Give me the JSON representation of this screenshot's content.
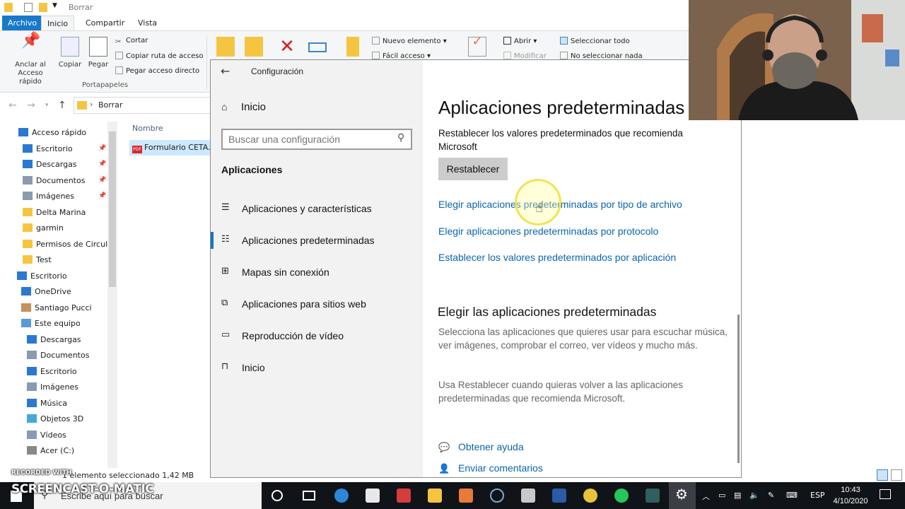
{
  "explorer": {
    "title": "Borrar",
    "tabs": [
      "Archivo",
      "Inicio",
      "Compartir",
      "Vista"
    ],
    "ribbon": {
      "pin_label_1": "Anclar al",
      "pin_label_2": "Acceso rápido",
      "copy": "Copiar",
      "paste": "Pegar",
      "cut": "Cortar",
      "copy_path": "Copiar ruta de acceso",
      "paste_shortcut": "Pegar acceso directo",
      "clipboard_group": "Portapapeles",
      "new_item": "Nuevo elemento",
      "easy_access": "Fácil acceso",
      "open": "Abrir",
      "modify": "Modificar",
      "select_all": "Seleccionar todo",
      "select_none": "No seleccionar nada"
    },
    "breadcrumb": "Borrar",
    "nav_pane": [
      {
        "label": "Acceso rápido",
        "icon": "star-icon",
        "pinned": false
      },
      {
        "label": "Escritorio",
        "icon": "desktop-icon",
        "pinned": true
      },
      {
        "label": "Descargas",
        "icon": "download-icon",
        "pinned": true
      },
      {
        "label": "Documentos",
        "icon": "documents-icon",
        "pinned": true
      },
      {
        "label": "Imágenes",
        "icon": "pictures-icon",
        "pinned": true
      },
      {
        "label": "Delta Marina",
        "icon": "folder-icon",
        "pinned": false
      },
      {
        "label": "garmin",
        "icon": "folder-icon",
        "pinned": false
      },
      {
        "label": "Permisos de Circulac",
        "icon": "folder-icon",
        "pinned": false
      },
      {
        "label": "Test",
        "icon": "folder-icon",
        "pinned": false
      },
      {
        "label": "Escritorio",
        "icon": "desktop-icon",
        "pinned": false
      },
      {
        "label": "OneDrive",
        "icon": "cloud-icon",
        "pinned": false
      },
      {
        "label": "Santiago Pucci",
        "icon": "user-icon",
        "pinned": false
      },
      {
        "label": "Este equipo",
        "icon": "computer-icon",
        "pinned": false
      },
      {
        "label": "Descargas",
        "icon": "download-icon",
        "pinned": false
      },
      {
        "label": "Documentos",
        "icon": "documents-icon",
        "pinned": false
      },
      {
        "label": "Escritorio",
        "icon": "desktop-icon",
        "pinned": false
      },
      {
        "label": "Imágenes",
        "icon": "pictures-icon",
        "pinned": false
      },
      {
        "label": "Música",
        "icon": "music-icon",
        "pinned": false
      },
      {
        "label": "Objetos 3D",
        "icon": "cube-icon",
        "pinned": false
      },
      {
        "label": "Vídeos",
        "icon": "video-icon",
        "pinned": false
      },
      {
        "label": "Acer (C:)",
        "icon": "drive-icon",
        "pinned": false
      }
    ],
    "column_name": "Nombre",
    "file_name": "Formulario CETA.pdf",
    "pdf_badge": "PDF",
    "status": "1 elemento seleccionado  1,42 MB"
  },
  "settings": {
    "window_title": "Configuración",
    "home": "Inicio",
    "search_placeholder": "Buscar una configuración",
    "section": "Aplicaciones",
    "menu": [
      {
        "label": "Aplicaciones y características",
        "icon": "list-icon",
        "selected": false
      },
      {
        "label": "Aplicaciones predeterminadas",
        "icon": "default-apps-icon",
        "selected": true
      },
      {
        "label": "Mapas sin conexión",
        "icon": "map-icon",
        "selected": false
      },
      {
        "label": "Aplicaciones para sitios web",
        "icon": "web-apps-icon",
        "selected": false
      },
      {
        "label": "Reproducción de vídeo",
        "icon": "video-icon",
        "selected": false
      },
      {
        "label": "Inicio",
        "icon": "startup-icon",
        "selected": false
      }
    ],
    "page_title": "Aplicaciones predeterminadas",
    "reset_description": "Restablecer los valores predeterminados que recomienda Microsoft",
    "reset_button": "Restablecer",
    "links": [
      "Elegir aplicaciones predeterminadas por tipo de archivo",
      "Elegir aplicaciones predeterminadas por protocolo",
      "Establecer los valores predeterminados por aplicación"
    ],
    "subheading": "Elegir las aplicaciones predeterminadas",
    "paragraph_1": "Selecciona las aplicaciones que quieres usar para escuchar música, ver imágenes, comprobar el correo, ver vídeos y mucho más.",
    "paragraph_2": "Usa Restablecer cuando quieras volver a las aplicaciones predeterminadas que recomienda Microsoft.",
    "help": "Obtener ayuda",
    "feedback": "Enviar comentarios"
  },
  "taskbar": {
    "search_placeholder": "Escribe aquí para buscar",
    "language": "ESP",
    "time": "10:43",
    "date": "4/10/2020"
  },
  "watermark": {
    "line1": "RECORDED WITH",
    "line2": "SCREENCAST-O-MATIC"
  },
  "colors": {
    "accent": "#1a73c7",
    "link": "#0a64ad",
    "file_tab": "#1979ca",
    "selection": "#cce8ff",
    "taskbar": "#101318"
  }
}
